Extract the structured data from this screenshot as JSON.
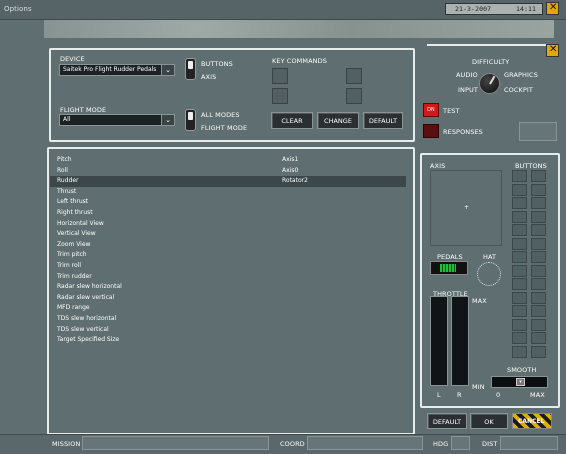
{
  "window": {
    "title": "Options",
    "date": "21-3-2007",
    "time": "14:11"
  },
  "device": {
    "label": "DEVICE",
    "selected": "Saitek Pro Flight Rudder Pedals"
  },
  "flight_mode": {
    "label": "FLIGHT MODE",
    "selected": "All"
  },
  "toggle1": {
    "top": "BUTTONS",
    "bottom": "AXIS"
  },
  "toggle2": {
    "top": "ALL MODES",
    "bottom": "FLIGHT MODE"
  },
  "key_commands": {
    "label": "KEY COMMANDS",
    "clear": "CLEAR",
    "change": "CHANGE",
    "default": "DEFAULT"
  },
  "difficulty": {
    "label": "DIFFICULTY",
    "audio": "AUDIO",
    "input": "INPUT",
    "graphics": "GRAPHICS",
    "cockpit": "COCKPIT"
  },
  "test": {
    "button": "ON",
    "label": "TEST"
  },
  "responses": {
    "label": "RESPONSES"
  },
  "bindings": [
    {
      "name": "Pitch",
      "value": "Axis1"
    },
    {
      "name": "Roll",
      "value": "Axis0"
    },
    {
      "name": "Rudder",
      "value": "Rotator2"
    },
    {
      "name": "Thrust",
      "value": ""
    },
    {
      "name": "Left thrust",
      "value": ""
    },
    {
      "name": "Right thrust",
      "value": ""
    },
    {
      "name": "Horizontal View",
      "value": ""
    },
    {
      "name": "Vertical View",
      "value": ""
    },
    {
      "name": "Zoom View",
      "value": ""
    },
    {
      "name": "Trim pitch",
      "value": ""
    },
    {
      "name": "Trim roll",
      "value": ""
    },
    {
      "name": "Trim rudder",
      "value": ""
    },
    {
      "name": "Radar slew horizontal",
      "value": ""
    },
    {
      "name": "Radar slew vertical",
      "value": ""
    },
    {
      "name": "MFD range",
      "value": ""
    },
    {
      "name": "TDS slew horizontal",
      "value": ""
    },
    {
      "name": "TDS slew vertical",
      "value": ""
    },
    {
      "name": "Target Specified Size",
      "value": ""
    }
  ],
  "selected_binding": "Rudder",
  "right_panel": {
    "axis": "AXIS",
    "buttons": "BUTTONS",
    "pedals": "PEDALS",
    "hat": "HAT",
    "throttle": "THROTTLE",
    "max": "MAX",
    "min": "MIN",
    "l": "L",
    "r": "R",
    "smooth": "SMOOTH",
    "smooth_min": "0",
    "smooth_max": "MAX"
  },
  "footer": {
    "default": "DEFAULT",
    "ok": "OK",
    "cancel": "CANCEL",
    "mission": "MISSION",
    "coord": "COORD",
    "hdg": "HDG",
    "dist": "DIST"
  }
}
